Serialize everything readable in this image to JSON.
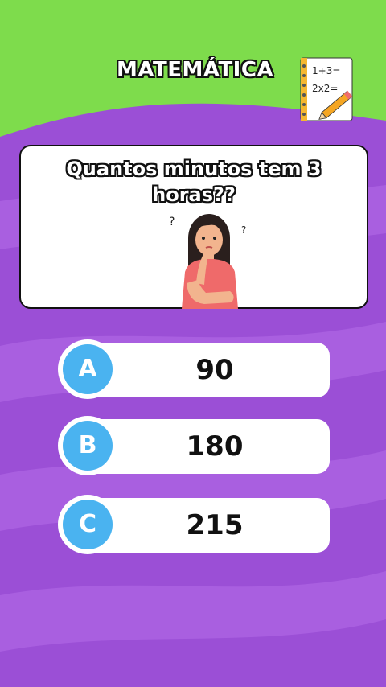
{
  "header": {
    "title": "MATEMÁTICA",
    "notebook_line1": "1+3=",
    "notebook_line2": "2x2="
  },
  "question": {
    "text_line1": "Quantos minutos tem 3",
    "text_line2": "horas??"
  },
  "answers": [
    {
      "letter": "A",
      "value": "90"
    },
    {
      "letter": "B",
      "value": "180"
    },
    {
      "letter": "C",
      "value": "215"
    }
  ],
  "colors": {
    "header_green": "#7edc4c",
    "background_purple": "#9b4fd6",
    "stripe_purple": "#a95fe0",
    "answer_blue": "#4ab3f0",
    "card_white": "#ffffff"
  }
}
